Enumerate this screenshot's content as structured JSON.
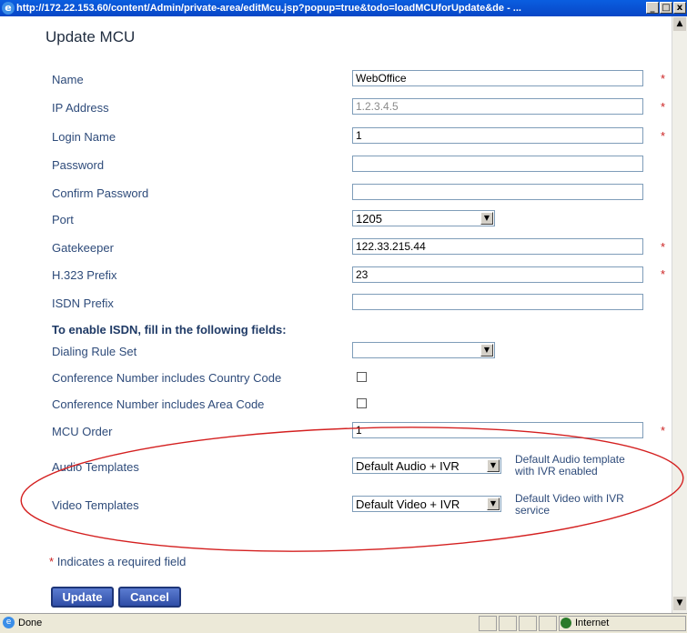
{
  "window": {
    "title": "http://172.22.153.60/content/Admin/private-area/editMcu.jsp?popup=true&todo=loadMCUforUpdate&de - ...",
    "minimize": "_",
    "maximize": "□",
    "close": "x"
  },
  "page_title": "Update MCU",
  "fields": {
    "name": {
      "label": "Name",
      "value": "WebOffice"
    },
    "ip": {
      "label": "IP Address",
      "value": "1.2.3.4.5"
    },
    "login": {
      "label": "Login Name",
      "value": "1"
    },
    "password": {
      "label": "Password",
      "value": ""
    },
    "confirm_password": {
      "label": "Confirm Password",
      "value": ""
    },
    "port": {
      "label": "Port",
      "value": "1205"
    },
    "gatekeeper": {
      "label": "Gatekeeper",
      "value": "122.33.215.44"
    },
    "h323": {
      "label": "H.323 Prefix",
      "value": "23"
    },
    "isdn": {
      "label": "ISDN Prefix",
      "value": ""
    },
    "dialing_rule": {
      "label": "Dialing Rule Set",
      "value": ""
    },
    "country_code": {
      "label": "Conference Number includes Country Code"
    },
    "area_code": {
      "label": "Conference Number includes Area Code"
    },
    "mcu_order": {
      "label": "MCU Order",
      "value": "1"
    },
    "audio": {
      "label": "Audio Templates",
      "value": "Default Audio + IVR",
      "desc_line1": "Default Audio template",
      "desc_line2": "with IVR enabled"
    },
    "video": {
      "label": "Video Templates",
      "value": "Default Video + IVR",
      "desc_line1": "Default Video with IVR",
      "desc_line2": "service"
    }
  },
  "isdn_heading": "To enable ISDN, fill in the following fields:",
  "required_star": "*",
  "required_note": "Indicates a required field",
  "buttons": {
    "update": "Update",
    "cancel": "Cancel"
  },
  "statusbar": {
    "status": "Done",
    "zone": "Internet"
  },
  "colors": {
    "required": "#cc2222",
    "label": "#2e4b7a",
    "annotation": "#d42020",
    "button": "#3a58b4"
  }
}
